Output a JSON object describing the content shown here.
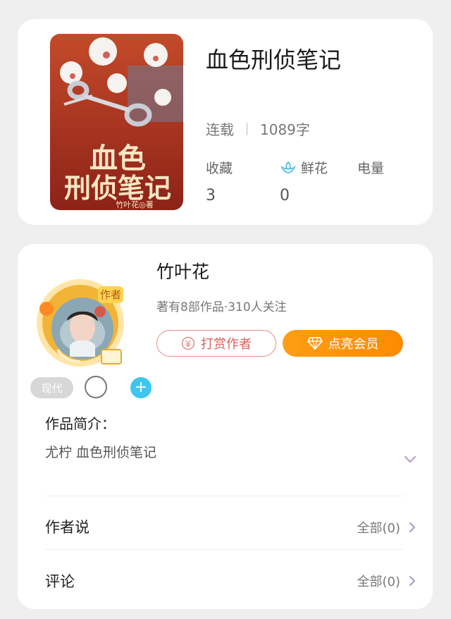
{
  "book": {
    "title": "血色刑侦笔记",
    "status": "连载",
    "word_count": "1089字",
    "stats": [
      {
        "label": "收藏",
        "value": "3",
        "icon": "none"
      },
      {
        "label": "鲜花",
        "value": "0",
        "icon": "flower-icon"
      },
      {
        "label": "电量",
        "value": "",
        "icon": "none"
      }
    ],
    "cover": {
      "title_line1": "血色",
      "title_line2": "刑侦笔记",
      "author_mark": "竹叶花◎著",
      "accent_color": "#a33a24"
    }
  },
  "author": {
    "name": "竹叶花",
    "meta": "著有8部作品·310人关注",
    "badge": "作者",
    "reward_button": "打赏作者",
    "member_button": "点亮会员",
    "tag": "现代"
  },
  "intro": {
    "title": "作品简介：",
    "text": "尤柠 血色刑侦笔记"
  },
  "sections": [
    {
      "title": "作者说",
      "right": "全部(0)"
    },
    {
      "title": "评论",
      "right": "全部(0)"
    }
  ]
}
